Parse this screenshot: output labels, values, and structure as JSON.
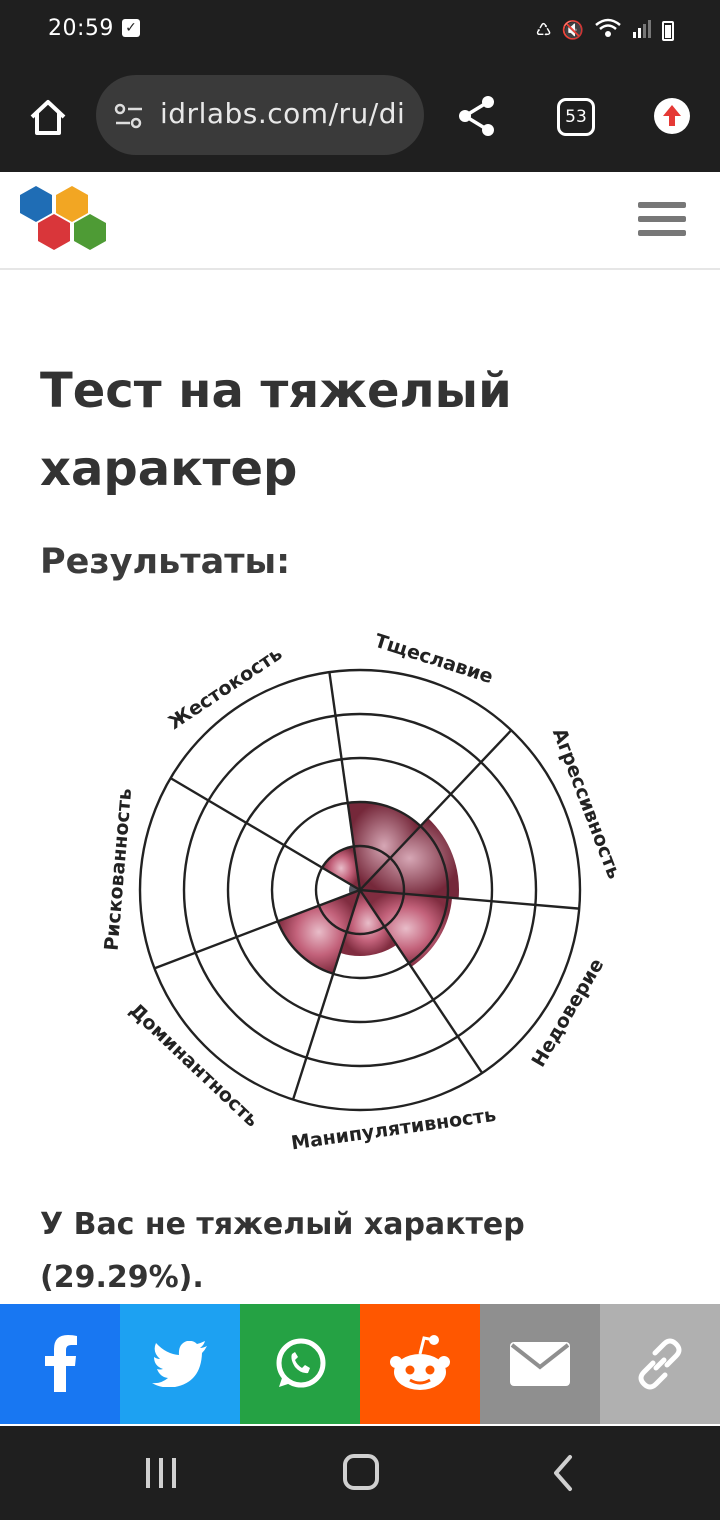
{
  "status_bar": {
    "time": "20:59"
  },
  "browser": {
    "url": "idrlabs.com/ru/di",
    "tab_count": "53"
  },
  "page": {
    "title": "Тест на тяжелый характер",
    "results_heading": "Результаты:",
    "result_text": "У Вас не тяжелый характер (29.29%)."
  },
  "chart_data": {
    "type": "polar-area",
    "categories": [
      "Тщеславие",
      "Агрессивность",
      "Недоверие",
      "Манипулятивность",
      "Доминантность",
      "Рискованность",
      "Жестокость"
    ],
    "values": [
      40,
      45,
      42,
      30,
      40,
      5,
      20
    ],
    "rings": 5,
    "max": 100,
    "colors": {
      "fill_dark": "#7a2236",
      "fill_mid": "#b8455f",
      "fill_light": "#e7b9c6",
      "small_slice": "#4b4f5a"
    }
  },
  "share_bar": [
    {
      "name": "facebook",
      "color": "#1877f2"
    },
    {
      "name": "twitter",
      "color": "#1da1f2"
    },
    {
      "name": "whatsapp",
      "color": "#25a244"
    },
    {
      "name": "reddit",
      "color": "#ff5700"
    },
    {
      "name": "email",
      "color": "#8f8f8f"
    },
    {
      "name": "link",
      "color": "#b0b0b0"
    }
  ]
}
